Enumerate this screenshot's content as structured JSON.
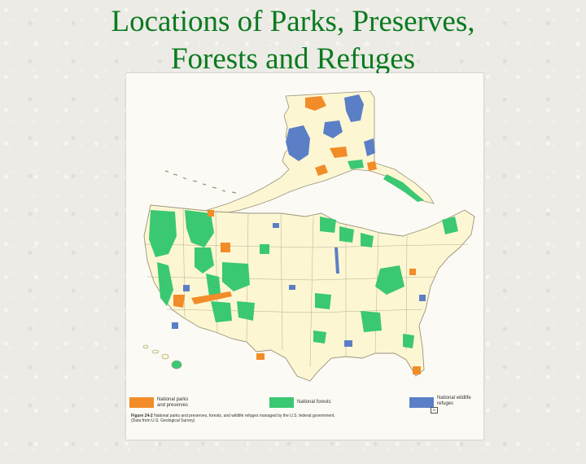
{
  "slide": {
    "title_line1": "Locations of Parks, Preserves,",
    "title_line2": "Forests and Refuges"
  },
  "legend": [
    {
      "label_line1": "National parks",
      "label_line2": "and preserves",
      "color": "#f28c28"
    },
    {
      "label_line1": "National forests",
      "label_line2": "",
      "color": "#3bc872"
    },
    {
      "label_line1": "National wildlife",
      "label_line2": "refuges",
      "color": "#5b7fc6"
    }
  ],
  "caption": {
    "figure_label": "Figure 24-2",
    "text": "National parks and preserves, forests, and wildlife refuges managed by the U.S. federal government.",
    "source": "(Data from U.S. Geological Survey)"
  },
  "colors": {
    "land": "#fdf6d3",
    "state_border": "#9a9378",
    "forest": "#3bc872",
    "park": "#f28c28",
    "refuge": "#5b7fc6",
    "title": "#0a7a1f"
  }
}
